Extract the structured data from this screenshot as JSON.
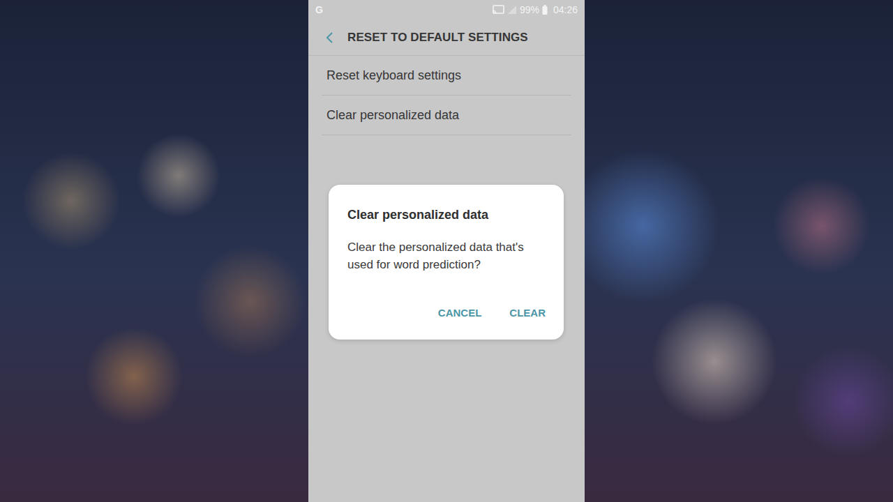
{
  "status_bar": {
    "left_icon": "G",
    "battery": "99%",
    "time": "04:26"
  },
  "header": {
    "title": "RESET TO DEFAULT SETTINGS"
  },
  "settings": [
    {
      "label": "Reset keyboard settings"
    },
    {
      "label": "Clear personalized data"
    }
  ],
  "dialog": {
    "title": "Clear personalized data",
    "message": "Clear the personalized data that's used for word prediction?",
    "buttons": [
      "CANCEL",
      "CLEAR"
    ]
  }
}
